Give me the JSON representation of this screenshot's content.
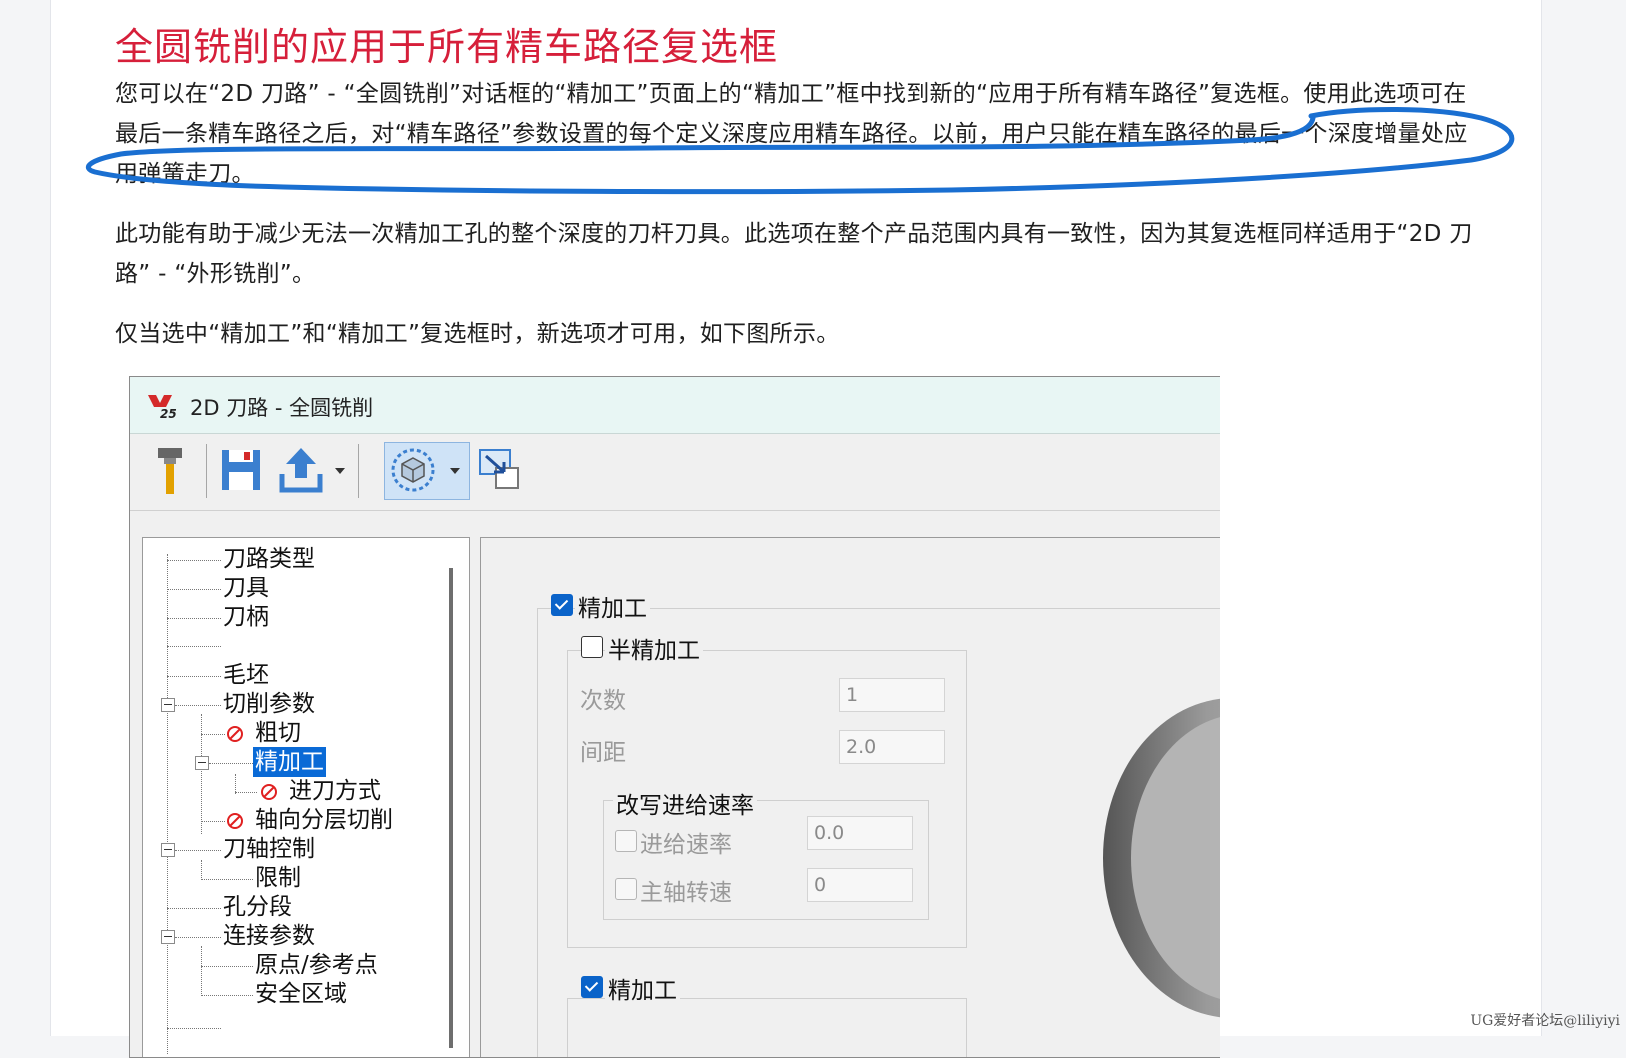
{
  "article": {
    "title": "全圆铣削的应用于所有精车路径复选框",
    "paragraph1": "您可以在“2D 刀路” - “全圆铣削”对话框的“精加工”页面上的“精加工”框中找到新的“应用于所有精车路径”复选框。使用此选项可在最后一条精车路径之后，对“精车路径”参数设置的每个定义深度应用精车路径。以前，用户只能在精车路径的最后一个深度增量处应用弹簧走刀。",
    "paragraph2": "此功能有助于减少无法一次精加工孔的整个深度的刀杆刀具。此选项在整个产品范围内具有一致性，因为其复选框同样适用于“2D 刀路” - “外形铣削”。",
    "paragraph3": "仅当选中“精加工”和“精加工”复选框时，新选项才可用，如下图所示。"
  },
  "dialog": {
    "title": "2D 刀路 - 全圆铣削",
    "logo_text": "25",
    "tree": {
      "items": [
        "刀路类型",
        "刀具",
        "刀柄",
        "毛坯",
        "切削参数",
        "粗切",
        "精加工",
        "进刀方式",
        "轴向分层切削",
        "刀轴控制",
        "限制",
        "孔分段",
        "连接参数",
        "原点/参考点",
        "安全区域"
      ]
    },
    "finish_section": {
      "finish_label": "精加工",
      "semi_finish_label": "半精加工",
      "passes_label": "次数",
      "passes_value": "1",
      "spacing_label": "间距",
      "spacing_value": "2.0",
      "override_feed_label": "改写进给速率",
      "feed_rate_label": "进给速率",
      "feed_rate_value": "0.0",
      "spindle_label": "主轴转速",
      "spindle_value": "0",
      "finish2_label": "精加工"
    }
  },
  "watermark": "UG爱好者论坛@liliyiyi",
  "colors": {
    "title_red": "#d61f3a",
    "annotation_blue": "#1a6fd1",
    "selection_blue": "#0a6ad6",
    "checkbox_blue": "#0a63c9"
  }
}
